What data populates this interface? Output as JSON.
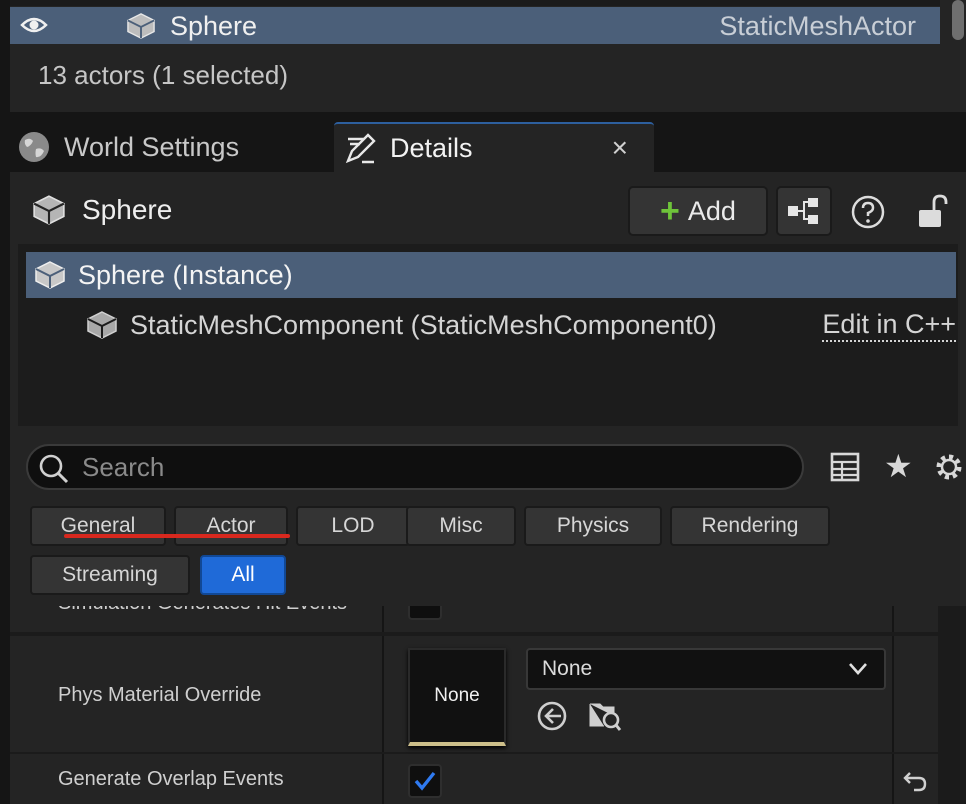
{
  "outliner": {
    "row": {
      "label": "Sphere",
      "type": "StaticMeshActor"
    },
    "actor_count": "13 actors (1 selected)"
  },
  "tabs": {
    "world_settings": "World Settings",
    "details": "Details",
    "close_glyph": "×"
  },
  "details": {
    "actor_name": "Sphere",
    "add_plus": "+",
    "add_label": "Add",
    "components": [
      {
        "label": "Sphere (Instance)"
      },
      {
        "label": "StaticMeshComponent (StaticMeshComponent0)",
        "action": "Edit in C++"
      }
    ],
    "search_placeholder": "Search",
    "star_glyph": "★",
    "filters": [
      "General",
      "Actor",
      "LOD",
      "Misc",
      "Physics",
      "Rendering",
      "Streaming",
      "All"
    ],
    "active_filter": "All"
  },
  "properties": {
    "simulation_hit_events": {
      "label": "Simulation Generates Hit Events",
      "checked": false
    },
    "phys_material_override": {
      "label": "Phys Material Override",
      "thumb_text": "None",
      "combo_value": "None"
    },
    "generate_overlap_events": {
      "label": "Generate Overlap Events",
      "checked": true
    }
  },
  "colors": {
    "selection": "#4b5f79",
    "accent_blue": "#1f6ad8",
    "add_green": "#6ec43a",
    "annotation_red": "#d8281e"
  }
}
